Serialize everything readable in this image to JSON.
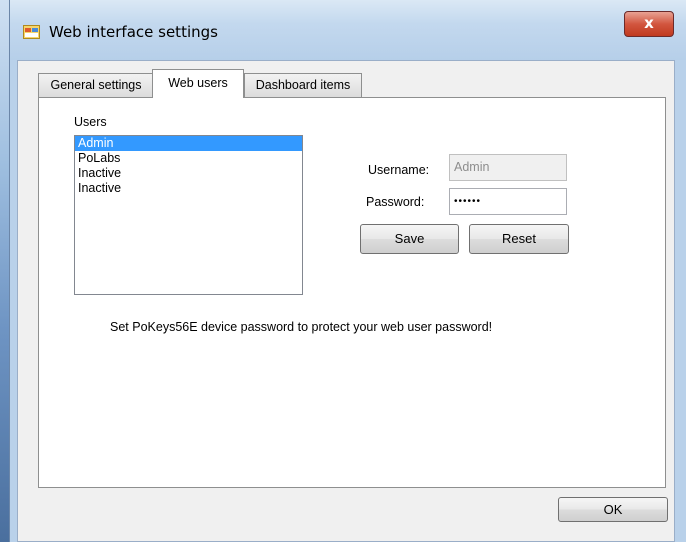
{
  "window": {
    "title": "Web interface settings",
    "close_glyph": "x",
    "icon": "app-window-icon"
  },
  "tabs": [
    {
      "label": "General settings",
      "active": false
    },
    {
      "label": "Web users",
      "active": true
    },
    {
      "label": "Dashboard items",
      "active": false
    }
  ],
  "users": {
    "label": "Users",
    "items": [
      {
        "label": "Admin",
        "selected": true
      },
      {
        "label": "PoLabs",
        "selected": false
      },
      {
        "label": "Inactive",
        "selected": false
      },
      {
        "label": "Inactive",
        "selected": false
      }
    ]
  },
  "form": {
    "username_label": "Username:",
    "username_value": "Admin",
    "password_label": "Password:",
    "password_value": "••••••",
    "save_label": "Save",
    "reset_label": "Reset"
  },
  "note": "Set PoKeys56E device password to protect your web user password!",
  "ok_label": "OK",
  "colors": {
    "selection": "#3399ff",
    "titlebar": "#b9d1ea",
    "close_button": "#c0391f"
  }
}
